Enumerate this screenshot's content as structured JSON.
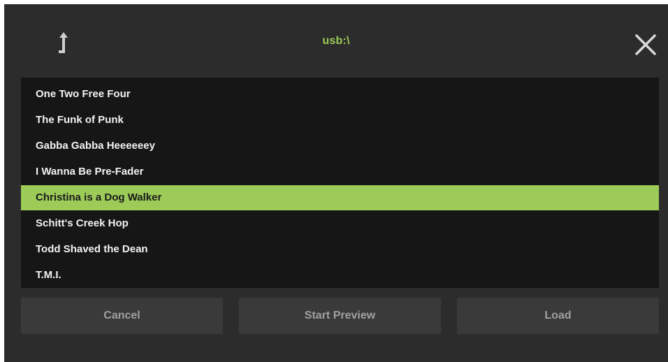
{
  "header": {
    "path": "usb:\\",
    "up_icon": "up-arrow-icon",
    "close_icon": "close-icon"
  },
  "file_list": {
    "items": [
      "One Two Free Four",
      "The Funk of Punk",
      "Gabba Gabba Heeeeeey",
      "I Wanna Be Pre-Fader",
      "Christina is a Dog Walker",
      "Schitt's Creek Hop",
      "Todd Shaved the Dean",
      "T.M.I."
    ],
    "selected_index": 4
  },
  "footer": {
    "cancel_label": "Cancel",
    "preview_label": "Start Preview",
    "load_label": "Load"
  },
  "colors": {
    "accent": "#9ccb58",
    "background": "#2c2c2c",
    "list_background": "#161616",
    "button_background": "#3a3a3a",
    "button_text": "#a0a0a0"
  }
}
